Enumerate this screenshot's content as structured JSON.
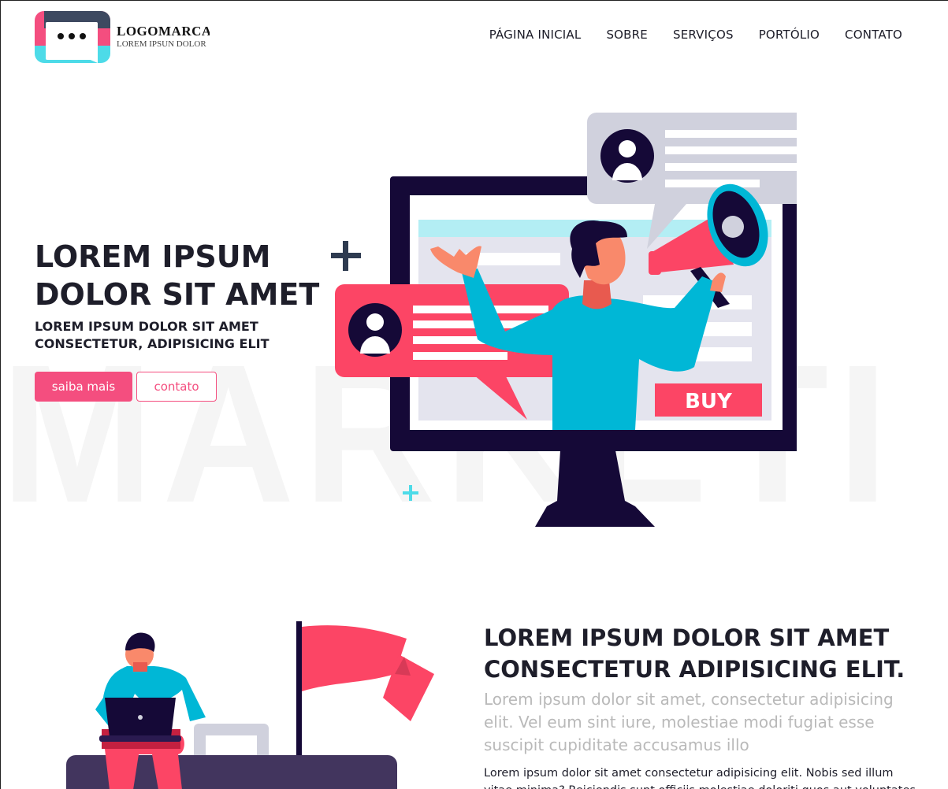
{
  "header": {
    "logo_title": "LOGOMARCA",
    "logo_subtitle": "LOREM IPSUN DOLOR",
    "nav": [
      "PÁGINA INICIAL",
      "SOBRE",
      "SERVIÇOS",
      "PORTÓLIO",
      "CONTATO"
    ]
  },
  "hero": {
    "title": "LOREM IPSUM DOLOR SIT AMET",
    "subtitle": "LOREM IPSUM DOLOR SIT AMET CONSECTETUR, ADIPISICING ELIT",
    "primary_button": "saiba mais",
    "secondary_button": "contato",
    "watermark": "MARKETING",
    "illustration_button": "BUY"
  },
  "section2": {
    "title": "LOREM IPSUM DOLOR SIT AMET CONSECTETUR ADIPISICING ELIT.",
    "lead": "Lorem ipsum dolor sit amet, consectetur adipisicing elit. Vel eum sint iure, molestiae modi fugiat esse suscipit cupiditate accusamus illo",
    "body": "Lorem ipsum dolor sit amet consectetur adipisicing elit. Nobis sed illum vitae minima? Reiciendis sunt officiis molestiae doloriti quos aut voluptates"
  },
  "colors": {
    "accent": "#f44e7f",
    "coral": "#fc4565",
    "teal": "#00b7d6",
    "navy": "#150937",
    "gray_bubble": "#d0d1dd"
  },
  "icons": [
    "chat-bubble-logo-icon",
    "plus-icon",
    "user-avatar-icon",
    "megaphone-icon",
    "flag-icon",
    "laptop-icon"
  ]
}
